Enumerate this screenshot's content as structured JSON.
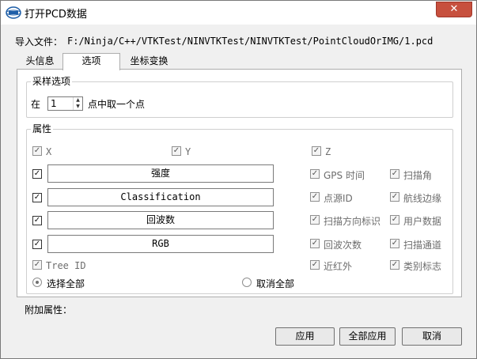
{
  "window": {
    "title": "打开PCD数据",
    "close_glyph": "✕",
    "icon": "app-logo-icon"
  },
  "import_file": {
    "label": "导入文件：",
    "path": "F:/Ninja/C++/VTKTest/NINVTKTest/NINVTKTest/PointCloudOrIMG/1.pcd"
  },
  "tabs": [
    {
      "label": "头信息"
    },
    {
      "label": "选项"
    },
    {
      "label": "坐标变换"
    }
  ],
  "sampling": {
    "title": "采样选项",
    "prefix": "在",
    "value": "1",
    "suffix": "点中取一个点"
  },
  "attributes": {
    "title": "属性",
    "xyz": [
      {
        "label": "X",
        "checked": true
      },
      {
        "label": "Y",
        "checked": true
      },
      {
        "label": "Z",
        "checked": true
      }
    ],
    "fields": [
      {
        "value": "强度",
        "checked": true
      },
      {
        "value": "Classification",
        "checked": true
      },
      {
        "value": "回波数",
        "checked": true
      },
      {
        "value": "RGB",
        "checked": true
      }
    ],
    "tree_id": {
      "label": "Tree ID",
      "checked": true
    },
    "middle": [
      {
        "label": "GPS 时间",
        "checked": true
      },
      {
        "label": "点源ID",
        "checked": true
      },
      {
        "label": "扫描方向标识",
        "checked": true
      },
      {
        "label": "回波次数",
        "checked": true
      },
      {
        "label": "近红外",
        "checked": true
      }
    ],
    "right": [
      {
        "label": "扫描角",
        "checked": true
      },
      {
        "label": "航线边缘",
        "checked": true
      },
      {
        "label": "用户数据",
        "checked": true
      },
      {
        "label": "扫描通道",
        "checked": true
      },
      {
        "label": "类别标志",
        "checked": true
      }
    ],
    "select_all": {
      "label": "选择全部",
      "selected": true
    },
    "deselect_all": {
      "label": "取消全部",
      "selected": false
    }
  },
  "extra_attributes": {
    "label": "附加属性："
  },
  "buttons": {
    "apply": "应用",
    "apply_all": "全部应用",
    "cancel": "取消"
  },
  "checkmark": "✓"
}
